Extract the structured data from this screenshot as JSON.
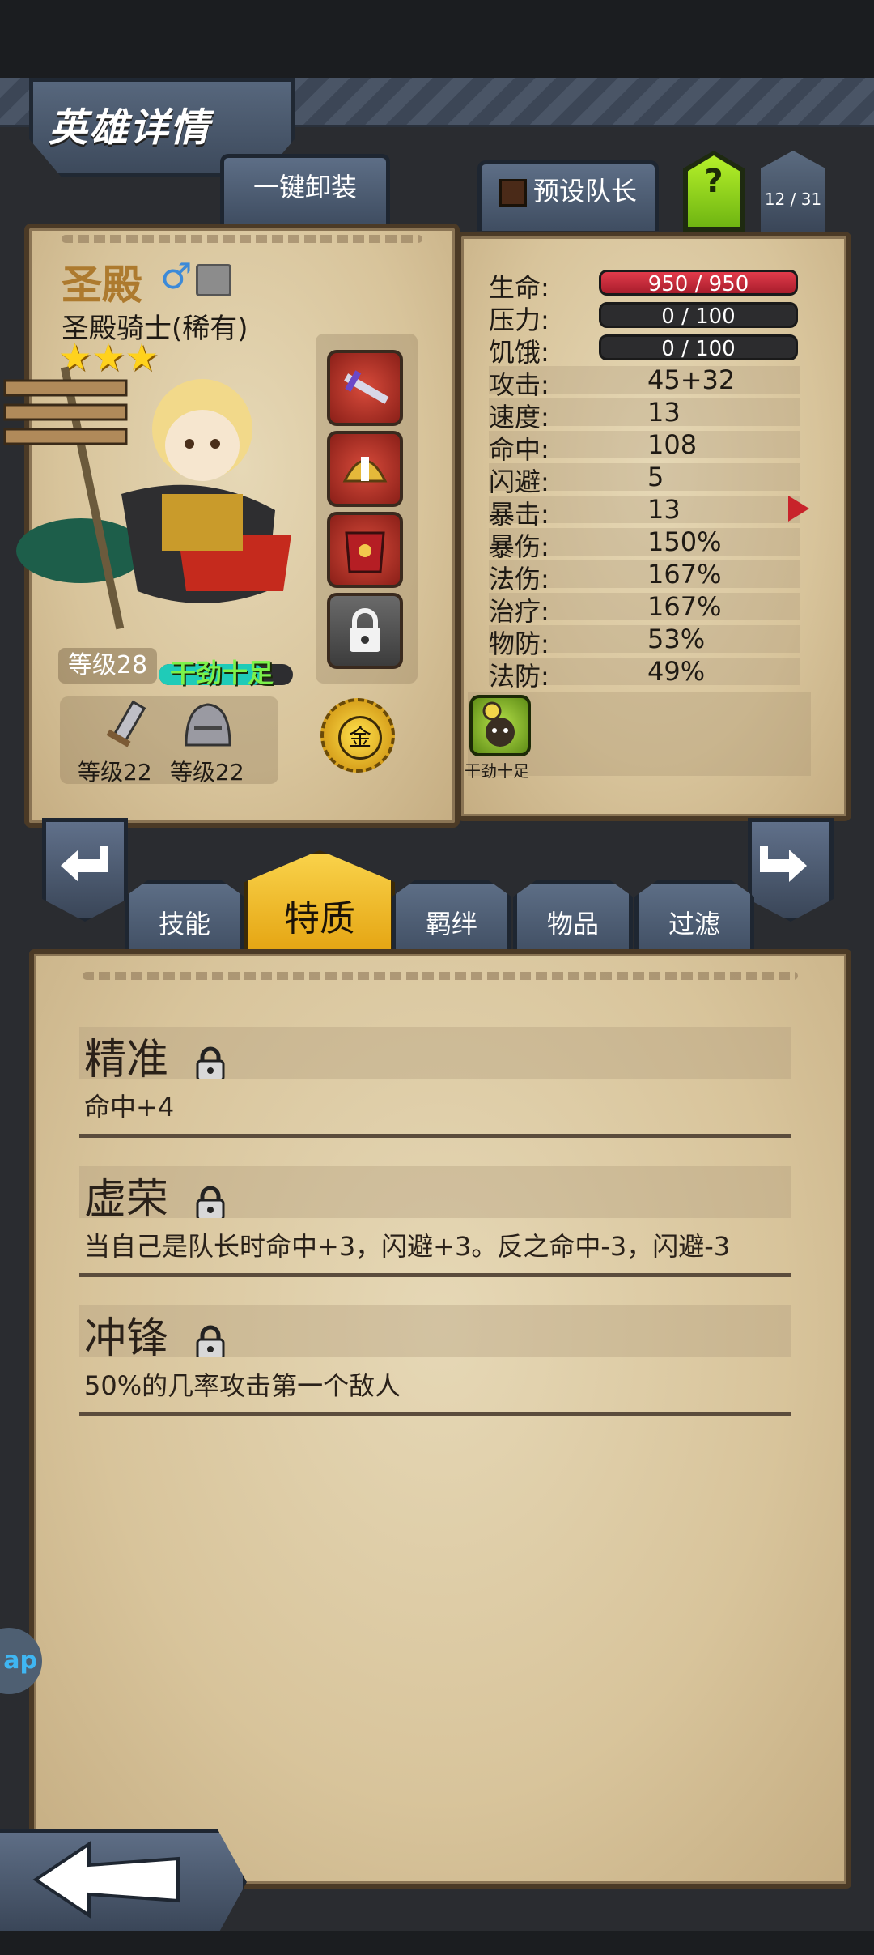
{
  "header": {
    "title": "英雄详情"
  },
  "top_buttons": {
    "unequip_all": "一键卸装",
    "preset_leader": "预设队长",
    "help": "?",
    "hero_count": "12 / 31"
  },
  "hero": {
    "name": "圣殿",
    "class": "圣殿骑士(稀有)",
    "stars": 3,
    "level": "等级28",
    "status": "干劲十足",
    "weapon_level": "等级22",
    "armor_level": "等级22",
    "gold_badge": "金"
  },
  "stats": [
    {
      "label": "生命:",
      "value": "950 / 950",
      "kind": "bar-red"
    },
    {
      "label": "压力:",
      "value": "0 / 100",
      "kind": "bar-dark"
    },
    {
      "label": "饥饿:",
      "value": "0 / 100",
      "kind": "bar-dark"
    },
    {
      "label": "攻击:",
      "value": "45+32"
    },
    {
      "label": "速度:",
      "value": "13"
    },
    {
      "label": "命中:",
      "value": "108"
    },
    {
      "label": "闪避:",
      "value": "5"
    },
    {
      "label": "暴击:",
      "value": "13"
    },
    {
      "label": "暴伤:",
      "value": "150%"
    },
    {
      "label": "法伤:",
      "value": "167%"
    },
    {
      "label": "治疗:",
      "value": "167%"
    },
    {
      "label": "物防:",
      "value": "53%"
    },
    {
      "label": "法防:",
      "value": "49%"
    }
  ],
  "mood_badge": {
    "label": "干劲十足"
  },
  "tabs": [
    {
      "label": "技能",
      "active": false
    },
    {
      "label": "特质",
      "active": true
    },
    {
      "label": "羁绊",
      "active": false
    },
    {
      "label": "物品",
      "active": false
    },
    {
      "label": "过滤",
      "active": false
    }
  ],
  "traits": [
    {
      "name": "精准",
      "desc": "命中+4"
    },
    {
      "name": "虚荣",
      "desc": "当自己是队长时命中+3，闪避+3。反之命中-3，闪避-3"
    },
    {
      "name": "冲锋",
      "desc": "50%的几率攻击第一个敌人"
    }
  ],
  "side_label": "ap",
  "colors": {
    "accent_green": "#9be31e",
    "hp_red": "#d12c3d",
    "tab_active": "#f3b819"
  }
}
